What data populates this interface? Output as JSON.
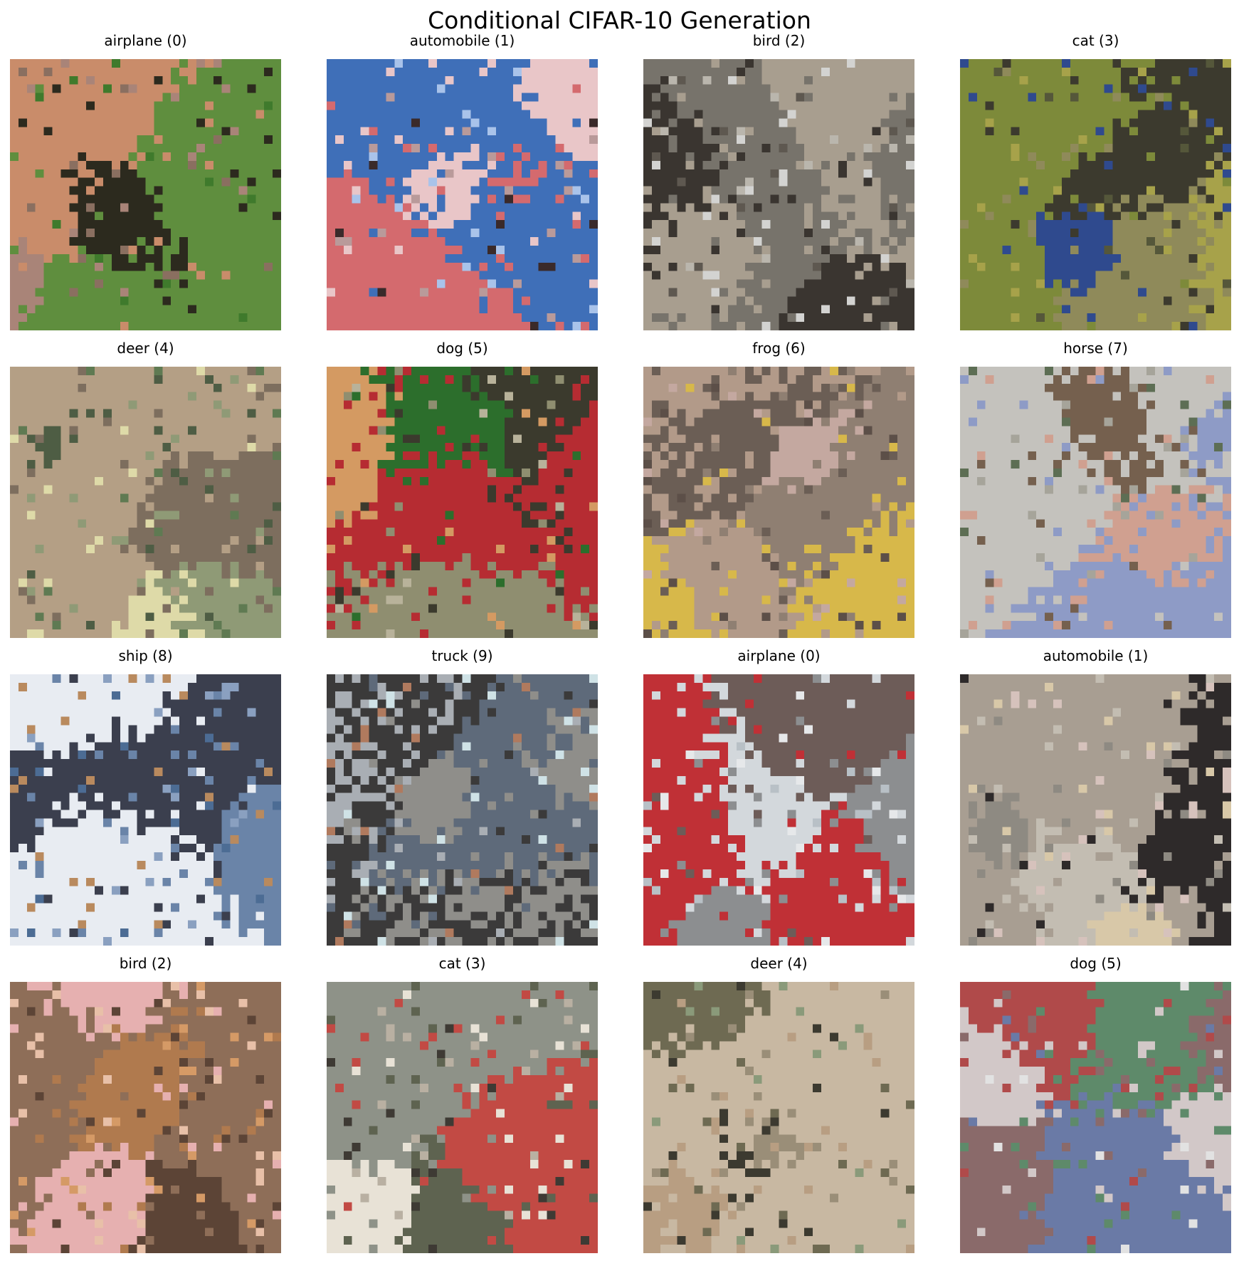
{
  "figure": {
    "title": "Conditional CIFAR-10 Generation"
  },
  "panels": [
    {
      "label": "airplane (0)",
      "palette": [
        "#3f7a2c",
        "#5f8e3e",
        "#c98c6a",
        "#a98478",
        "#2c2a1e",
        "#8a6f60"
      ]
    },
    {
      "label": "automobile (1)",
      "palette": [
        "#d46a6e",
        "#e9c6c8",
        "#3f6fb8",
        "#a9c3ea",
        "#3a2a2a",
        "#b99a9a"
      ]
    },
    {
      "label": "bird (2)",
      "palette": [
        "#d3d3d1",
        "#a89e8f",
        "#3a3530",
        "#77736b",
        "#bab6ad",
        "#5e5850"
      ]
    },
    {
      "label": "cat (3)",
      "palette": [
        "#7d8a3a",
        "#a7a24a",
        "#3c3a2e",
        "#55573a",
        "#2f4a8e",
        "#8f8a5a"
      ]
    },
    {
      "label": "deer (4)",
      "palette": [
        "#5f7a52",
        "#8f9a76",
        "#b49f85",
        "#7d6e5e",
        "#dedaa8",
        "#4e5d44"
      ]
    },
    {
      "label": "dog (5)",
      "palette": [
        "#b8b29a",
        "#8f8e70",
        "#d49a62",
        "#3b3a2d",
        "#b62c32",
        "#2c6e2c"
      ]
    },
    {
      "label": "frog (6)",
      "palette": [
        "#8f7f72",
        "#b29a89",
        "#d7b84a",
        "#6b5e55",
        "#c4a8a0",
        "#5c4f48"
      ]
    },
    {
      "label": "horse (7)",
      "palette": [
        "#a6a49a",
        "#8e9bc6",
        "#75604e",
        "#c4c2bd",
        "#5d6e54",
        "#d0a090"
      ]
    },
    {
      "label": "ship (8)",
      "palette": [
        "#6a84a8",
        "#8aa0c0",
        "#3b3f4e",
        "#e8ecf2",
        "#4c6c94",
        "#b98a5e"
      ]
    },
    {
      "label": "truck (9)",
      "palette": [
        "#cfe2e6",
        "#5e6a7a",
        "#8f8e8a",
        "#3b3a3a",
        "#b07a5e",
        "#a9aeb4"
      ]
    },
    {
      "label": "airplane (0)",
      "palette": [
        "#d3d8dc",
        "#b8c0c6",
        "#c03036",
        "#8c8e90",
        "#e6e8ea",
        "#6d5c58"
      ]
    },
    {
      "label": "automobile (1)",
      "palette": [
        "#8e8a82",
        "#c3bdb2",
        "#2e2a2a",
        "#d8c8a8",
        "#a89e92",
        "#d6c2bc"
      ]
    },
    {
      "label": "bird (2)",
      "palette": [
        "#d59a66",
        "#e8c0a8",
        "#5c4436",
        "#b07a4e",
        "#e6b0b0",
        "#8e6e58"
      ]
    },
    {
      "label": "cat (3)",
      "palette": [
        "#8e9288",
        "#b9b0a2",
        "#5e6350",
        "#e8e2d6",
        "#c24a44",
        "#3e3a34"
      ]
    },
    {
      "label": "deer (4)",
      "palette": [
        "#b89e82",
        "#9a8e78",
        "#6e6a52",
        "#c8b8a2",
        "#3c3a30",
        "#8a9a7a"
      ]
    },
    {
      "label": "dog (5)",
      "palette": [
        "#e2e2e2",
        "#b04a4a",
        "#8a6a6a",
        "#6a7aa6",
        "#d2c8c8",
        "#5e8a6a"
      ]
    }
  ]
}
